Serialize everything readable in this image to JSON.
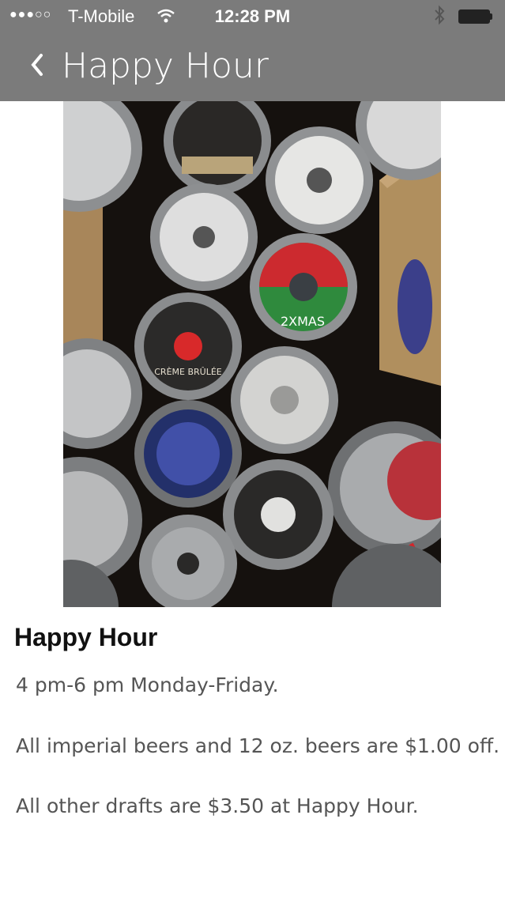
{
  "status_bar": {
    "signal": "●●●○○",
    "carrier": "T-Mobile",
    "time": "12:28 PM",
    "wifi_icon": "wifi-icon",
    "bluetooth_icon": "bluetooth-icon",
    "battery_icon": "battery-icon"
  },
  "nav": {
    "back_icon": "chevron-left-icon",
    "title": "Happy Hour"
  },
  "image": {
    "description_icon": "beer-kegs-photo",
    "keg_labels": [
      "2XMAS",
      "CRÈME BRÛLÉE"
    ]
  },
  "content": {
    "heading": "Happy Hour",
    "paragraphs": [
      "4 pm-6 pm Monday-Friday.",
      "All imperial beers and 12 oz. beers are $1.00 off.",
      "All other drafts are $3.50 at Happy Hour."
    ]
  },
  "colors": {
    "topbar": "#7b7b7b",
    "text": "#555555",
    "heading": "#111111"
  }
}
